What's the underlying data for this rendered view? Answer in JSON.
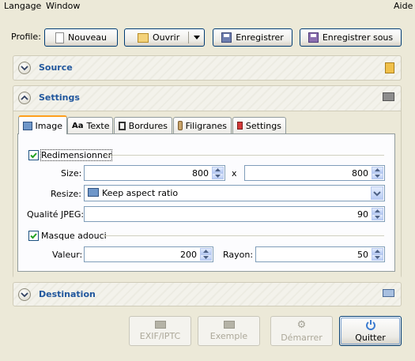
{
  "menubar": {
    "items": [
      "Langage",
      "Window"
    ],
    "help": "Aide"
  },
  "toolbar": {
    "profile_label": "Profile:",
    "new_label": "Nouveau",
    "open_label": "Ouvrir",
    "save_label": "Enregistrer",
    "save_as_label": "Enregistrer sous"
  },
  "sections": {
    "source": "Source",
    "settings": "Settings",
    "destination": "Destination"
  },
  "tabs": [
    "Image",
    "Texte",
    "Bordures",
    "Filigranes",
    "Settings"
  ],
  "image_tab": {
    "resize_group": "Redimensionner",
    "resize_checked": true,
    "size_label": "Size:",
    "width": "800",
    "times": "x",
    "height": "800",
    "resize_label": "Resize:",
    "resize_mode": "Keep aspect ratio",
    "jpeg_label": "Qualité JPEG:",
    "jpeg_value": "90",
    "unsharp_group": "Masque adouci",
    "unsharp_checked": true,
    "amount_label": "Valeur:",
    "amount_value": "200",
    "radius_label": "Rayon:",
    "radius_value": "50"
  },
  "actions": {
    "exif": "EXIF/IPTC",
    "preview": "Exemple",
    "start": "Démarrer",
    "quit": "Quitter"
  },
  "colors": {
    "accent": "#21579D",
    "tab_highlight": "#FF9F1C",
    "window_bg": "#ECE9D8"
  }
}
